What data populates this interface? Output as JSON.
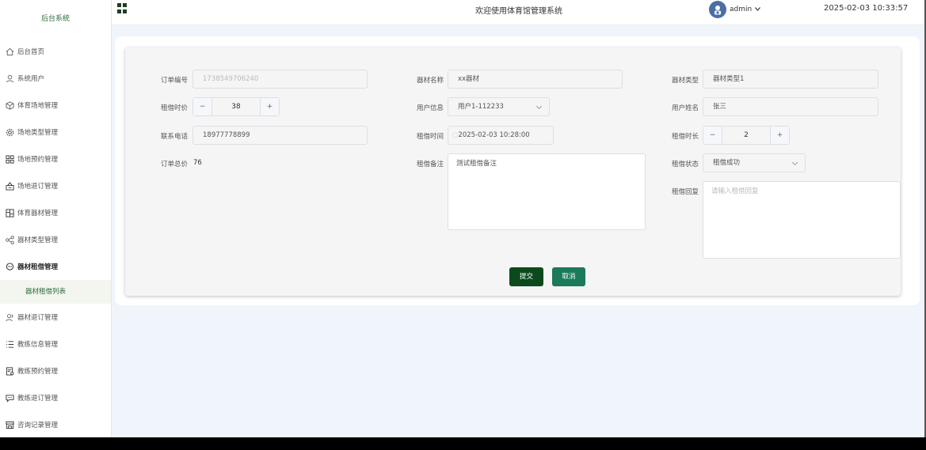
{
  "sidebar": {
    "brand": "后台系统",
    "items": [
      {
        "label": "后台首页",
        "icon": "home-icon"
      },
      {
        "label": "系统用户",
        "icon": "user-icon"
      },
      {
        "label": "体育场地管理",
        "icon": "cube-icon"
      },
      {
        "label": "场地类型管理",
        "icon": "gear-icon"
      },
      {
        "label": "场地预约管理",
        "icon": "grid-icon"
      },
      {
        "label": "场地退订管理",
        "icon": "box-icon"
      },
      {
        "label": "体育器材管理",
        "icon": "layout-icon"
      },
      {
        "label": "器材类型管理",
        "icon": "share-icon"
      },
      {
        "label": "器材租借管理",
        "icon": "chat-icon"
      }
    ],
    "sub_item": "器材租借列表",
    "items_after": [
      {
        "label": "器材退订管理",
        "icon": "users-icon"
      },
      {
        "label": "教练信息管理",
        "icon": "list-icon"
      },
      {
        "label": "教练预约管理",
        "icon": "doc-icon"
      },
      {
        "label": "教练退订管理",
        "icon": "message-icon"
      },
      {
        "label": "咨询记录管理",
        "icon": "store-icon"
      }
    ]
  },
  "header": {
    "title": "欢迎使用体育馆管理系统",
    "user": "admin",
    "clock": "2025-02-03 10:33:57"
  },
  "form": {
    "order_no_label": "订单编号",
    "order_no": "1738549706240",
    "equip_name_label": "器材名称",
    "equip_name": "xx器材",
    "equip_type_label": "器材类型",
    "equip_type": "器材类型1",
    "price_label": "租借时价",
    "price": "38",
    "user_info_label": "用户信息",
    "user_info": "用户1-112233",
    "user_name_label": "用户姓名",
    "user_name": "张三",
    "phone_label": "联系电话",
    "phone": "18977778899",
    "rent_time_label": "租借时间",
    "rent_time": "2025-02-03 10:28:00",
    "duration_label": "租借时长",
    "duration": "2",
    "total_label": "订单总价",
    "total": "76",
    "remark_label": "租借备注",
    "remark": "测试租借备注",
    "status_label": "租借状态",
    "status": "租借成功",
    "reply_label": "租借回复",
    "reply_placeholder": "请输入租借回复",
    "submit": "提交",
    "cancel": "取消"
  },
  "colors": {
    "submit": "#0b4a1c",
    "cancel": "#1a7a5a"
  }
}
